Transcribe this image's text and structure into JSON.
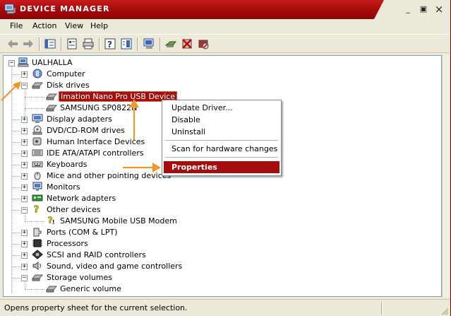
{
  "window": {
    "title": "Device Manager"
  },
  "titlebar_buttons": {
    "minimize": "_",
    "maximize": "▣",
    "close": "×"
  },
  "menu": {
    "items": [
      "File",
      "Action",
      "View",
      "Help"
    ]
  },
  "toolbar": {
    "buttons": [
      "back-icon",
      "forward-icon",
      "up-icon",
      "properties-icon",
      "print-icon",
      "help-icon",
      "view-icon",
      "scan-icon",
      "update-driver-icon",
      "uninstall-icon",
      "disable-icon"
    ]
  },
  "tree": {
    "root": "UALHALLA",
    "items": [
      {
        "label": "Computer",
        "expander": "+"
      },
      {
        "label": "Disk drives",
        "expander": "−"
      },
      {
        "label": "Imation Nano Pro USB Device",
        "child": true,
        "selected": true
      },
      {
        "label": "SAMSUNG SP0822N",
        "child": true
      },
      {
        "label": "Display adapters",
        "expander": "+"
      },
      {
        "label": "DVD/CD-ROM drives",
        "expander": "+"
      },
      {
        "label": "Human Interface Devices",
        "expander": "+"
      },
      {
        "label": "IDE ATA/ATAPI controllers",
        "expander": "+"
      },
      {
        "label": "Keyboards",
        "expander": "+"
      },
      {
        "label": "Mice and other pointing devices",
        "expander": "+"
      },
      {
        "label": "Monitors",
        "expander": "+"
      },
      {
        "label": "Network adapters",
        "expander": "+"
      },
      {
        "label": "Other devices",
        "expander": "−"
      },
      {
        "label": "SAMSUNG Mobile USB Modem",
        "child": true
      },
      {
        "label": "Ports (COM & LPT)",
        "expander": "+"
      },
      {
        "label": "Processors",
        "expander": "+"
      },
      {
        "label": "SCSI and RAID controllers",
        "expander": "+"
      },
      {
        "label": "Sound, video and game controllers",
        "expander": "+"
      },
      {
        "label": "Storage volumes",
        "expander": "−"
      },
      {
        "label": "Generic volume",
        "child": true
      }
    ]
  },
  "context_menu": {
    "items": [
      "Update Driver...",
      "Disable",
      "Uninstall",
      "Scan for hardware changes",
      "Properties"
    ],
    "highlighted": "Properties"
  },
  "status": {
    "text": "Opens property sheet for the current selection."
  },
  "colors": {
    "titlebar": "#a90c0c",
    "highlight": "#a30d0d",
    "annotation_arrow": "#f0962a"
  }
}
